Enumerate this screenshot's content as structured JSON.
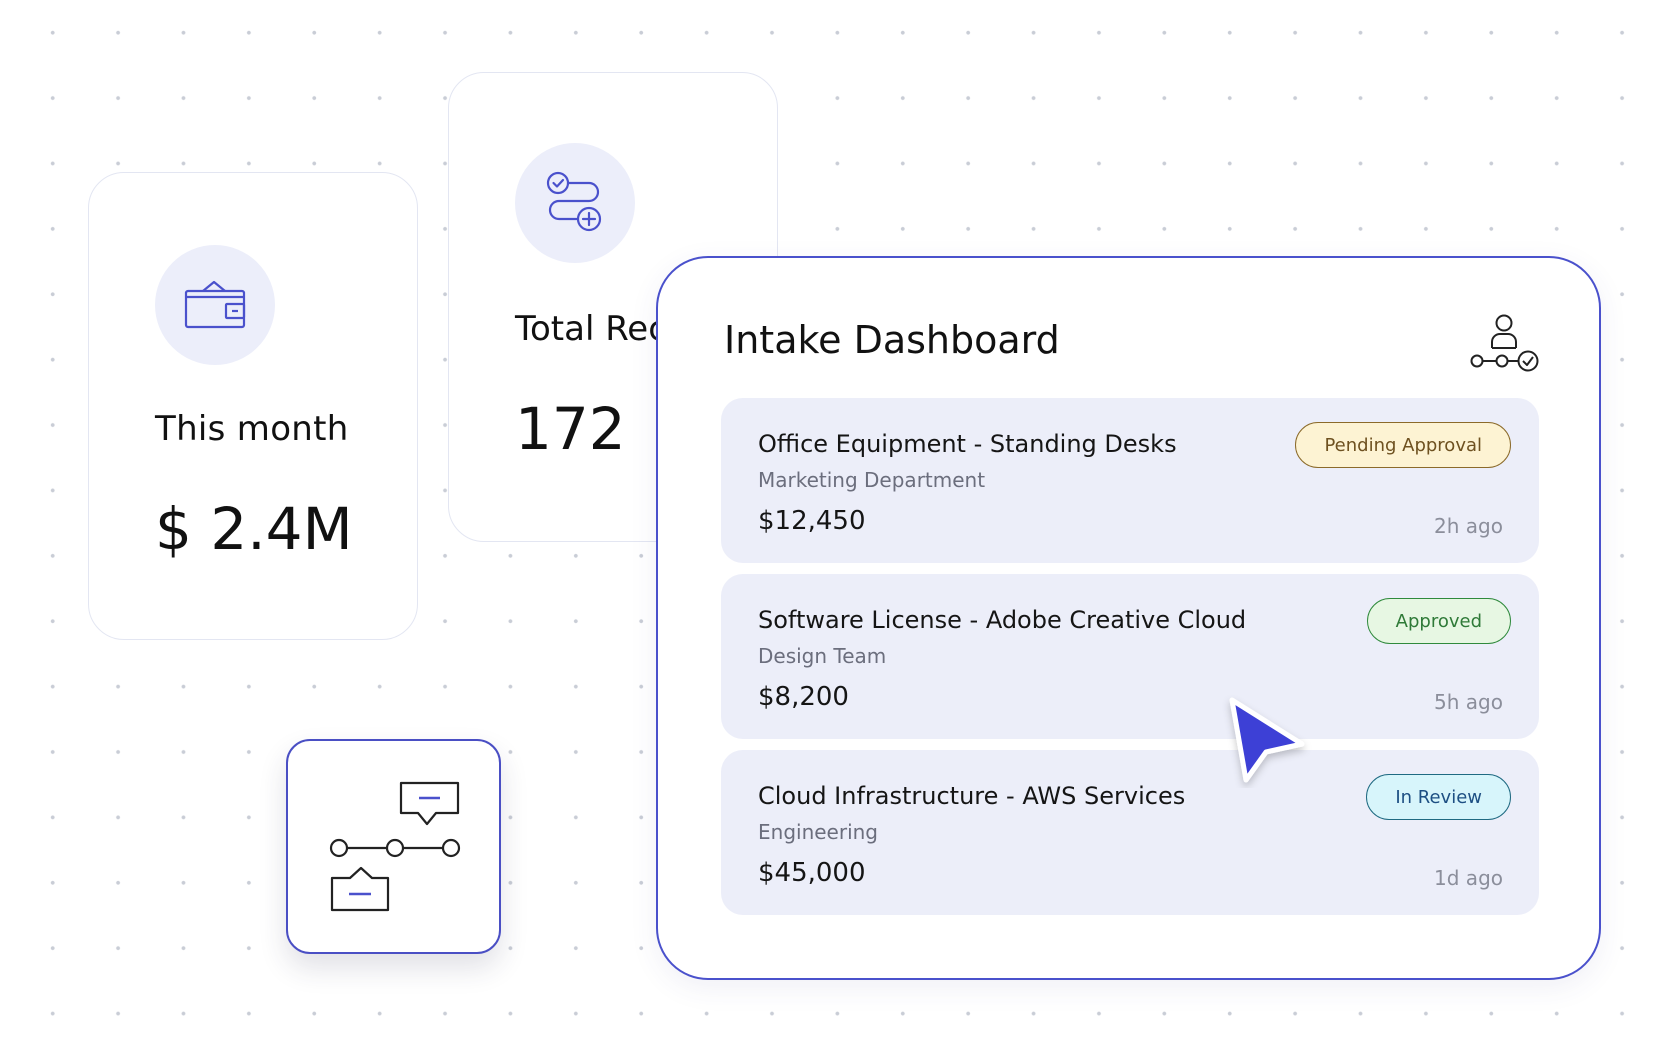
{
  "stats": {
    "month": {
      "label": "This month",
      "value": "$ 2.4M",
      "icon": "wallet-icon"
    },
    "total": {
      "label": "Total Rec",
      "value": "172",
      "icon": "workflow-add-icon"
    }
  },
  "dashboard": {
    "title": "Intake Dashboard",
    "header_icon": "approval-flow-icon",
    "items": [
      {
        "title": "Office Equipment - Standing Desks",
        "department": "Marketing Department",
        "amount": "$12,450",
        "status": "Pending Approval",
        "time": "2h ago"
      },
      {
        "title": "Software License - Adobe Creative Cloud",
        "department": "Design Team",
        "amount": "$8,200",
        "status": "Approved",
        "time": "5h ago"
      },
      {
        "title": "Cloud Infrastructure - AWS Services",
        "department": "Engineering",
        "amount": "$45,000",
        "status": "In Review",
        "time": "1d ago"
      }
    ]
  },
  "colors": {
    "accent": "#4a51cc",
    "card_tint": "#eceef9",
    "pending": "#fdf3d3",
    "approved": "#e7f7e3",
    "review": "#d7f5fb",
    "cursor": "#3c3fd6"
  },
  "workflow_tile": {
    "icon": "workflow-message-icon"
  }
}
